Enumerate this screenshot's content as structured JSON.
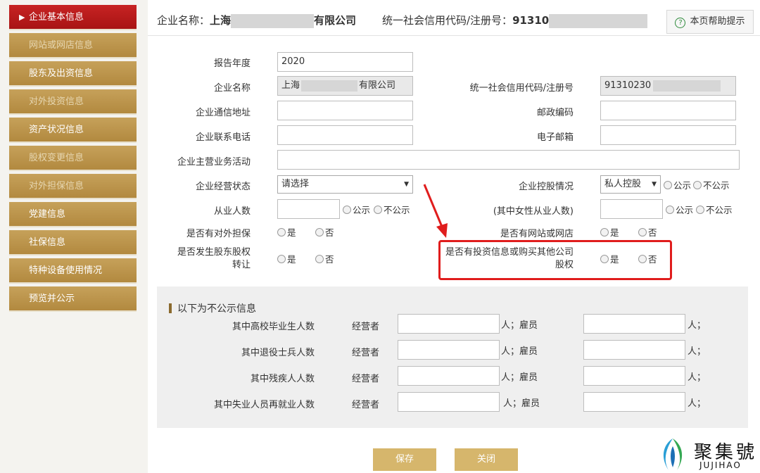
{
  "sidebar": {
    "items": [
      {
        "label": "企业基本信息",
        "active": true
      },
      {
        "label": "网站或网店信息"
      },
      {
        "label": "股东及出资信息"
      },
      {
        "label": "对外投资信息"
      },
      {
        "label": "资产状况信息"
      },
      {
        "label": "股权变更信息"
      },
      {
        "label": "对外担保信息"
      },
      {
        "label": "党建信息"
      },
      {
        "label": "社保信息"
      },
      {
        "label": "特种设备使用情况"
      },
      {
        "label": "预览并公示"
      }
    ]
  },
  "header": {
    "company_label": "企业名称：",
    "company_prefix": "上海",
    "company_suffix": "有限公司",
    "code_label": "统一社会信用代码/注册号：",
    "code_prefix": "91310",
    "help_label": "本页帮助提示"
  },
  "form": {
    "report_year": {
      "label": "报告年度",
      "value": "2020"
    },
    "company_name": {
      "label": "企业名称",
      "prefix": "上海",
      "suffix": "有限公司"
    },
    "credit_code": {
      "label": "统一社会信用代码/注册号",
      "prefix": "91310230"
    },
    "address": {
      "label": "企业通信地址",
      "value": ""
    },
    "postcode": {
      "label": "邮政编码",
      "value": ""
    },
    "phone": {
      "label": "企业联系电话",
      "value": ""
    },
    "email": {
      "label": "电子邮箱",
      "value": ""
    },
    "business": {
      "label": "企业主营业务活动",
      "value": ""
    },
    "status": {
      "label": "企业经营状态",
      "value": "请选择"
    },
    "holding": {
      "label": "企业控股情况",
      "value": "私人控股"
    },
    "employees": {
      "label": "从业人数",
      "value": ""
    },
    "female": {
      "label": "(其中女性从业人数)",
      "value": ""
    },
    "public": "公示",
    "nonpublic": "不公示",
    "yes": "是",
    "no": "否",
    "guarantee": {
      "label": "是否有对外担保"
    },
    "website": {
      "label": "是否有网站或网店"
    },
    "equity_transfer": {
      "label": "是否发生股东股权",
      "label2": "转让"
    },
    "investment": {
      "label": "是否有投资信息或购买其他公司",
      "label2": "股权"
    }
  },
  "non_public": {
    "title": "以下为不公示信息",
    "operator": "经营者",
    "employee_unit": "人；雇员",
    "unit": "人；",
    "rows": [
      {
        "label": "其中高校毕业生人数"
      },
      {
        "label": "其中退役士兵人数"
      },
      {
        "label": "其中残疾人人数"
      },
      {
        "label": "其中失业人员再就业人数"
      }
    ]
  },
  "buttons": {
    "save": "保存",
    "close": "关闭"
  },
  "watermark": {
    "cn": "聚集號",
    "en": "JUJIHAO"
  },
  "colors": {
    "active_nav": "#c72323",
    "nav": "#b8904a",
    "highlight": "#e01d1d"
  }
}
